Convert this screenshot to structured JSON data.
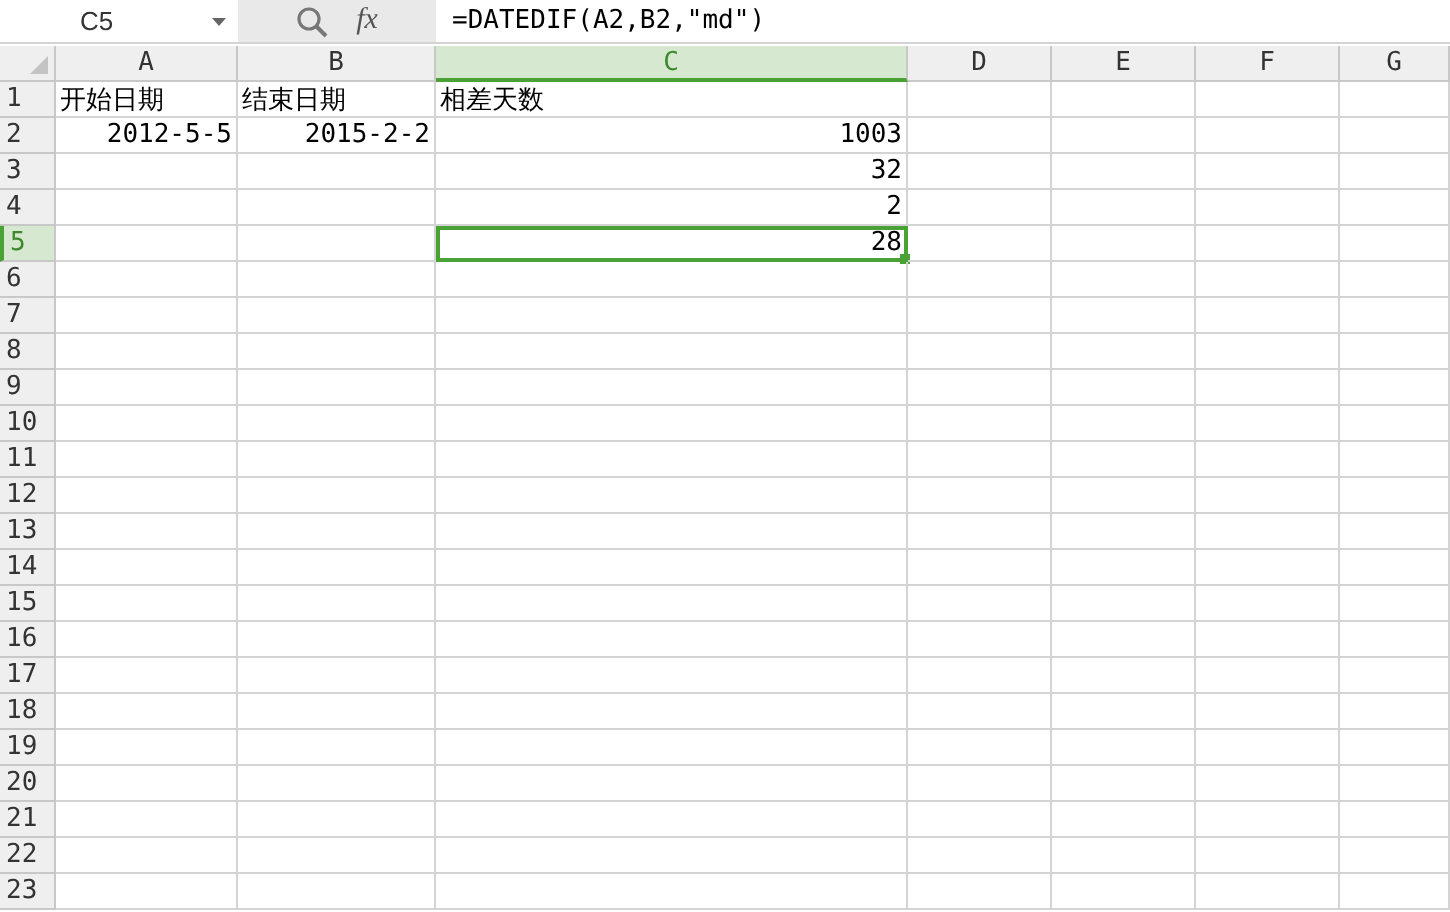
{
  "formula_bar": {
    "name_box": "C5",
    "function_label": "fx",
    "formula": "=DATEDIF(A2,B2,\"md\")"
  },
  "columns": [
    {
      "label": "A",
      "selected": false
    },
    {
      "label": "B",
      "selected": false
    },
    {
      "label": "C",
      "selected": true
    },
    {
      "label": "D",
      "selected": false
    },
    {
      "label": "E",
      "selected": false
    },
    {
      "label": "F",
      "selected": false
    },
    {
      "label": "G",
      "selected": false
    }
  ],
  "rows": [
    {
      "label": "1",
      "selected": false,
      "cells": [
        {
          "text": "开始日期",
          "kind": "text",
          "selected": false
        },
        {
          "text": "结束日期",
          "kind": "text",
          "selected": false
        },
        {
          "text": "相差天数",
          "kind": "text",
          "selected": false
        }
      ]
    },
    {
      "label": "2",
      "selected": false,
      "cells": [
        {
          "text": "2012-5-5",
          "kind": "number",
          "selected": false
        },
        {
          "text": "2015-2-2",
          "kind": "number",
          "selected": false
        },
        {
          "text": "1003",
          "kind": "number",
          "selected": false
        }
      ]
    },
    {
      "label": "3",
      "selected": false,
      "cells": [
        null,
        null,
        {
          "text": "32",
          "kind": "number",
          "selected": false
        }
      ]
    },
    {
      "label": "4",
      "selected": false,
      "cells": [
        null,
        null,
        {
          "text": "2",
          "kind": "number",
          "selected": false
        }
      ]
    },
    {
      "label": "5",
      "selected": true,
      "cells": [
        null,
        null,
        {
          "text": "28",
          "kind": "number",
          "selected": true
        }
      ]
    },
    {
      "label": "6",
      "selected": false
    },
    {
      "label": "7",
      "selected": false
    },
    {
      "label": "8",
      "selected": false
    },
    {
      "label": "9",
      "selected": false
    },
    {
      "label": "10",
      "selected": false
    },
    {
      "label": "11",
      "selected": false
    },
    {
      "label": "12",
      "selected": false
    },
    {
      "label": "13",
      "selected": false
    },
    {
      "label": "14",
      "selected": false
    },
    {
      "label": "15",
      "selected": false
    },
    {
      "label": "16",
      "selected": false
    },
    {
      "label": "17",
      "selected": false
    },
    {
      "label": "18",
      "selected": false
    },
    {
      "label": "19",
      "selected": false
    },
    {
      "label": "20",
      "selected": false
    },
    {
      "label": "21",
      "selected": false
    },
    {
      "label": "22",
      "selected": false
    },
    {
      "label": "23",
      "selected": false
    }
  ]
}
